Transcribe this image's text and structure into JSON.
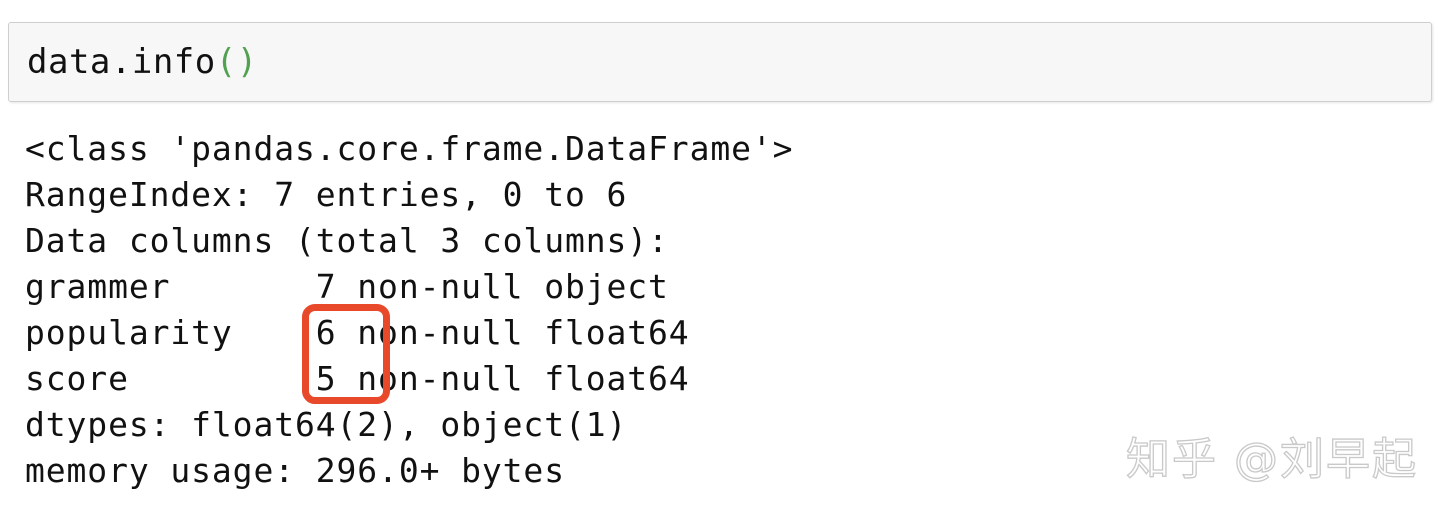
{
  "code_cell": {
    "expression_head": "data.info",
    "expression_parens": "()",
    "accent_paren_color": "#52a052",
    "background_color": "#f7f7f7",
    "border_color": "#cfcfcf"
  },
  "output": {
    "lines": [
      "<class 'pandas.core.frame.DataFrame'>",
      "RangeIndex: 7 entries, 0 to 6",
      "Data columns (total 3 columns):",
      "grammer       7 non-null object",
      "popularity    6 non-null float64",
      "score         5 non-null float64",
      "dtypes: float64(2), object(1)",
      "memory usage: 296.0+ bytes"
    ],
    "text_color": "#111111"
  },
  "annotation": {
    "highlight_color": "#e8492a",
    "highlighted_values": [
      "6",
      "5"
    ],
    "shape": "rounded-rectangle"
  },
  "watermark": {
    "text": "知乎 @刘早起",
    "color": "#c9c9c9"
  }
}
